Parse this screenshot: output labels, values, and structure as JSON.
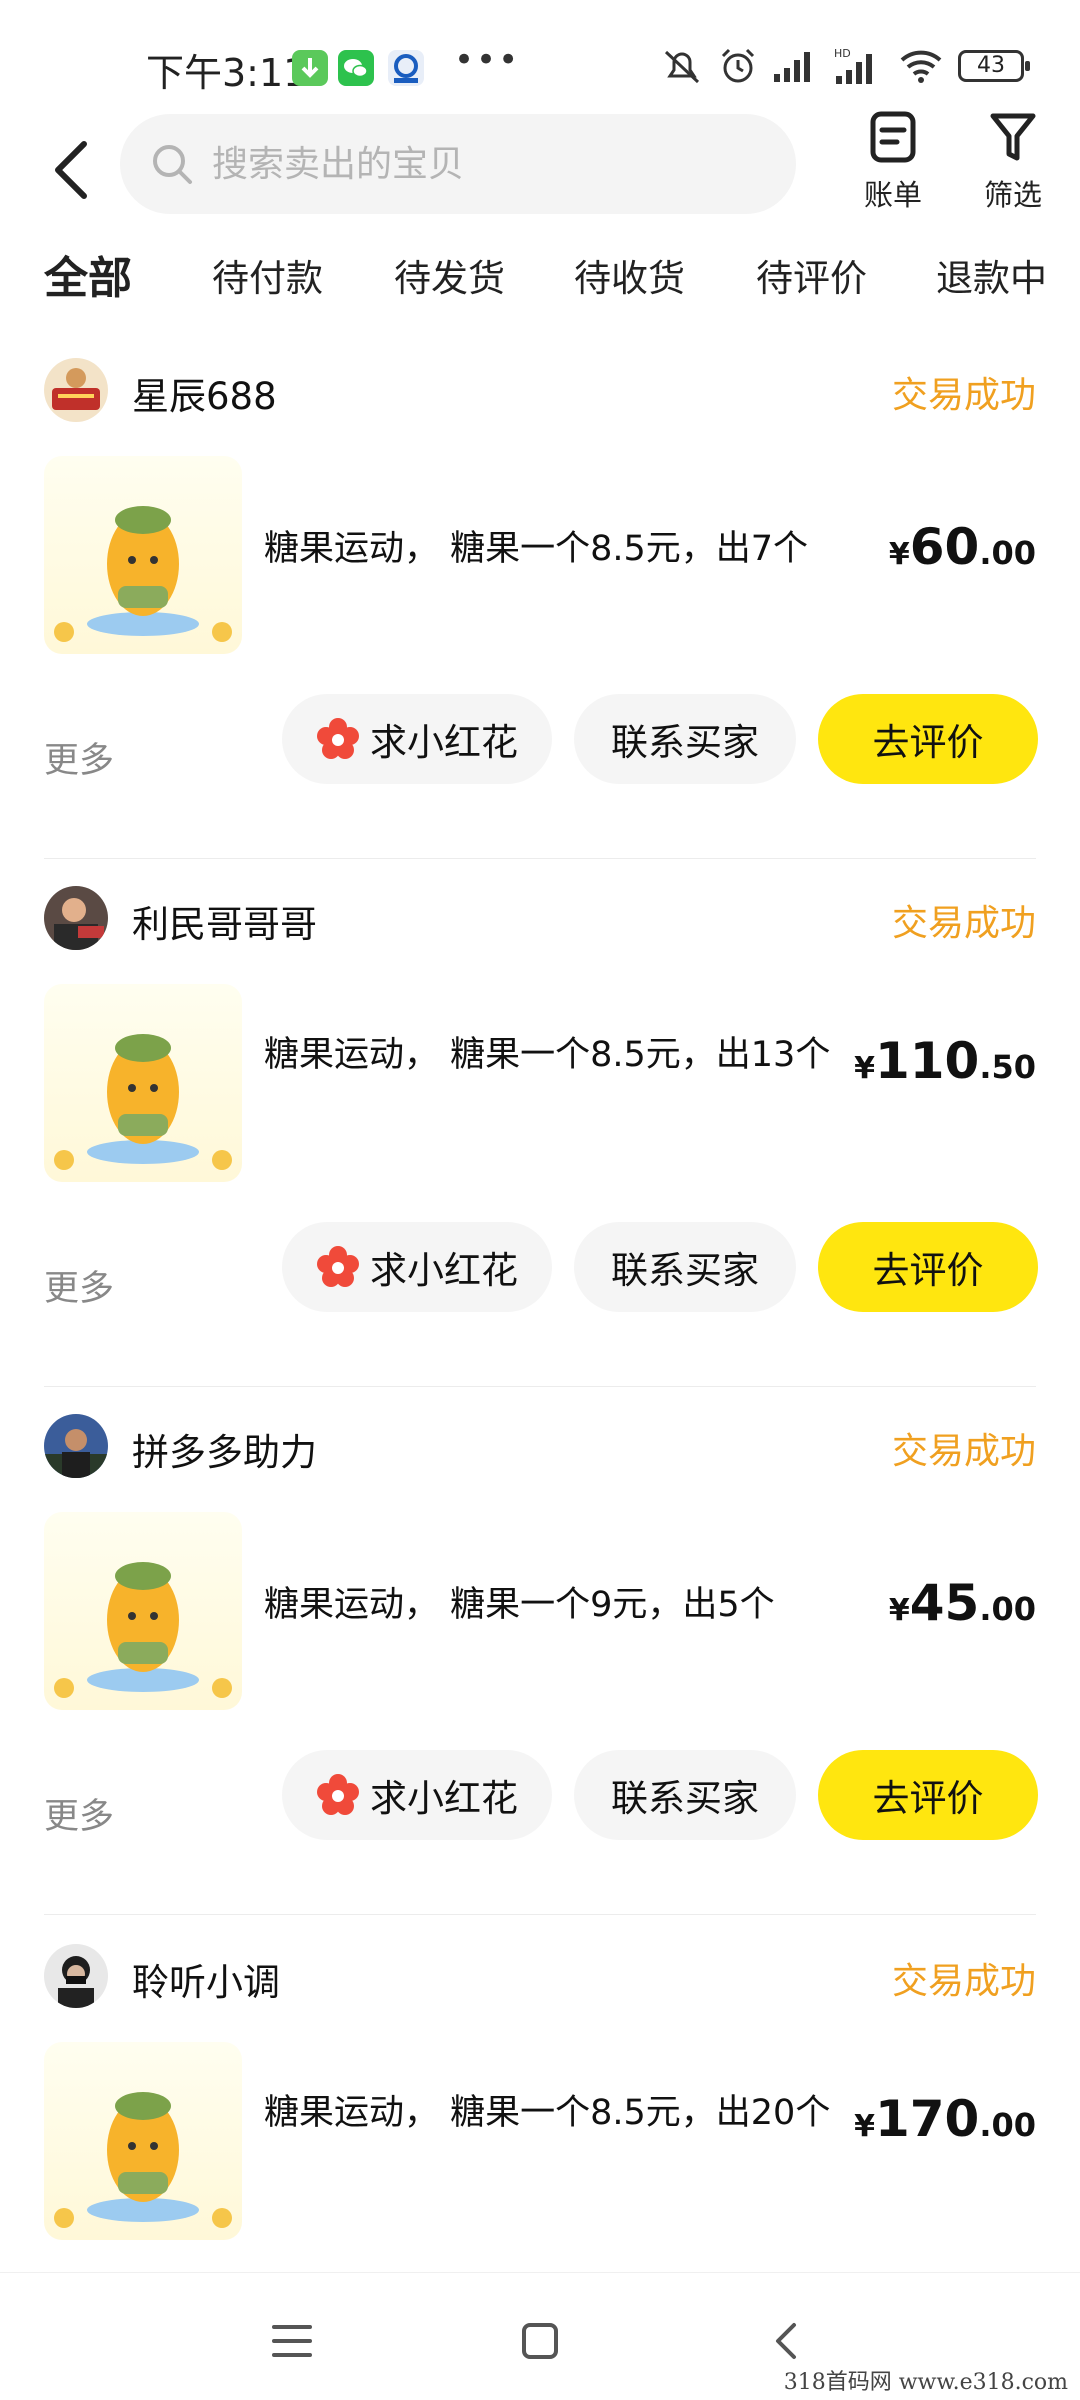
{
  "status_bar": {
    "time": "下午3:11",
    "battery": "43"
  },
  "header": {
    "search_placeholder": "搜索卖出的宝贝",
    "bill_label": "账单",
    "filter_label": "筛选"
  },
  "tabs": [
    {
      "label": "全部",
      "active": true
    },
    {
      "label": "待付款",
      "active": false
    },
    {
      "label": "待发货",
      "active": false
    },
    {
      "label": "待收货",
      "active": false
    },
    {
      "label": "待评价",
      "active": false
    },
    {
      "label": "退款中",
      "active": false
    }
  ],
  "orders": [
    {
      "seller": "星辰688",
      "status": "交易成功",
      "title": "糖果运动， 糖果一个8.5元，出7个",
      "price_currency": "¥",
      "price_int": "60",
      "price_dec": ".00",
      "more": "更多",
      "btn_flower": "求小红花",
      "btn_contact": "联系买家",
      "btn_review": "去评价"
    },
    {
      "seller": "利民哥哥哥",
      "status": "交易成功",
      "title": "糖果运动， 糖果一个8.5元，出13个",
      "price_currency": "¥",
      "price_int": "110",
      "price_dec": ".50",
      "more": "更多",
      "btn_flower": "求小红花",
      "btn_contact": "联系买家",
      "btn_review": "去评价"
    },
    {
      "seller": "拼多多助力",
      "status": "交易成功",
      "title": "糖果运动， 糖果一个9元，出5个",
      "price_currency": "¥",
      "price_int": "45",
      "price_dec": ".00",
      "more": "更多",
      "btn_flower": "求小红花",
      "btn_contact": "联系买家",
      "btn_review": "去评价"
    },
    {
      "seller": "聆听小调",
      "status": "交易成功",
      "title": "糖果运动， 糖果一个8.5元，出20个",
      "price_currency": "¥",
      "price_int": "170",
      "price_dec": ".00"
    }
  ],
  "watermark": "318首码网  www.e318.com",
  "colors": {
    "accent_yellow": "#ffe60f",
    "status_orange": "#f0a020",
    "flower_red": "#f04a3a"
  }
}
